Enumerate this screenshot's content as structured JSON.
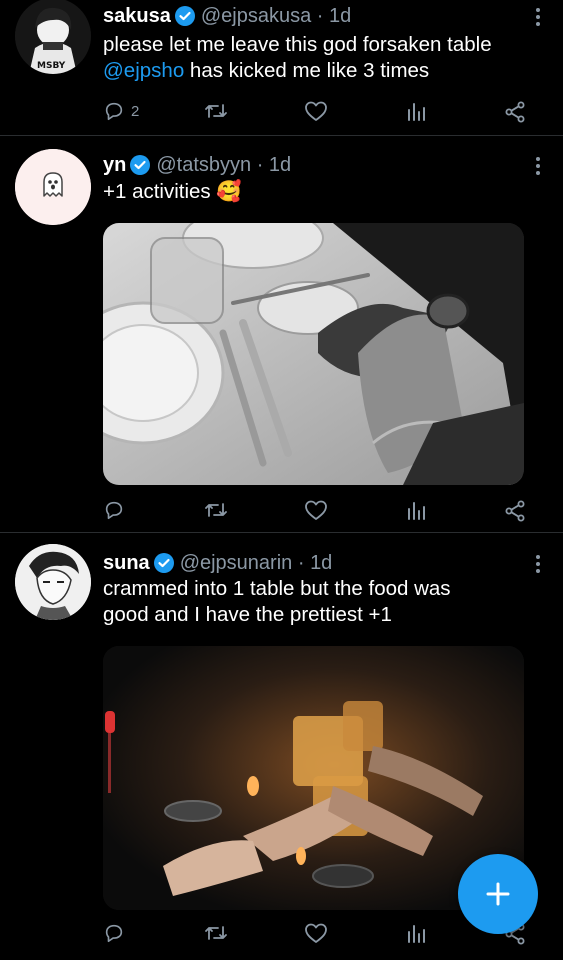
{
  "tweets": [
    {
      "name": "sakusa",
      "handle": "@ejpsakusa",
      "time": "1d",
      "text_parts": [
        "please let me leave this god forsaken table",
        "@ejpsho",
        " has kicked me like 3 times"
      ],
      "reply_count": "2"
    },
    {
      "name": "yn",
      "handle": "@tatsbyyn",
      "time": "1d",
      "text": "+1 activities 🥰"
    },
    {
      "name": "suna",
      "handle": "@ejpsunarin",
      "time": "1d",
      "text_line1": "crammed into 1 table but the food was",
      "text_line2": "good and I have the prettiest +1"
    }
  ],
  "icons": [
    "reply-icon",
    "retweet-icon",
    "like-icon",
    "analytics-icon",
    "share-icon",
    "verified-badge-icon",
    "more-icon",
    "compose-icon"
  ],
  "colors": {
    "background": "#000000",
    "accent": "#1d9bf0",
    "secondary_text": "#8b98a5",
    "divider": "#2a2d30"
  }
}
